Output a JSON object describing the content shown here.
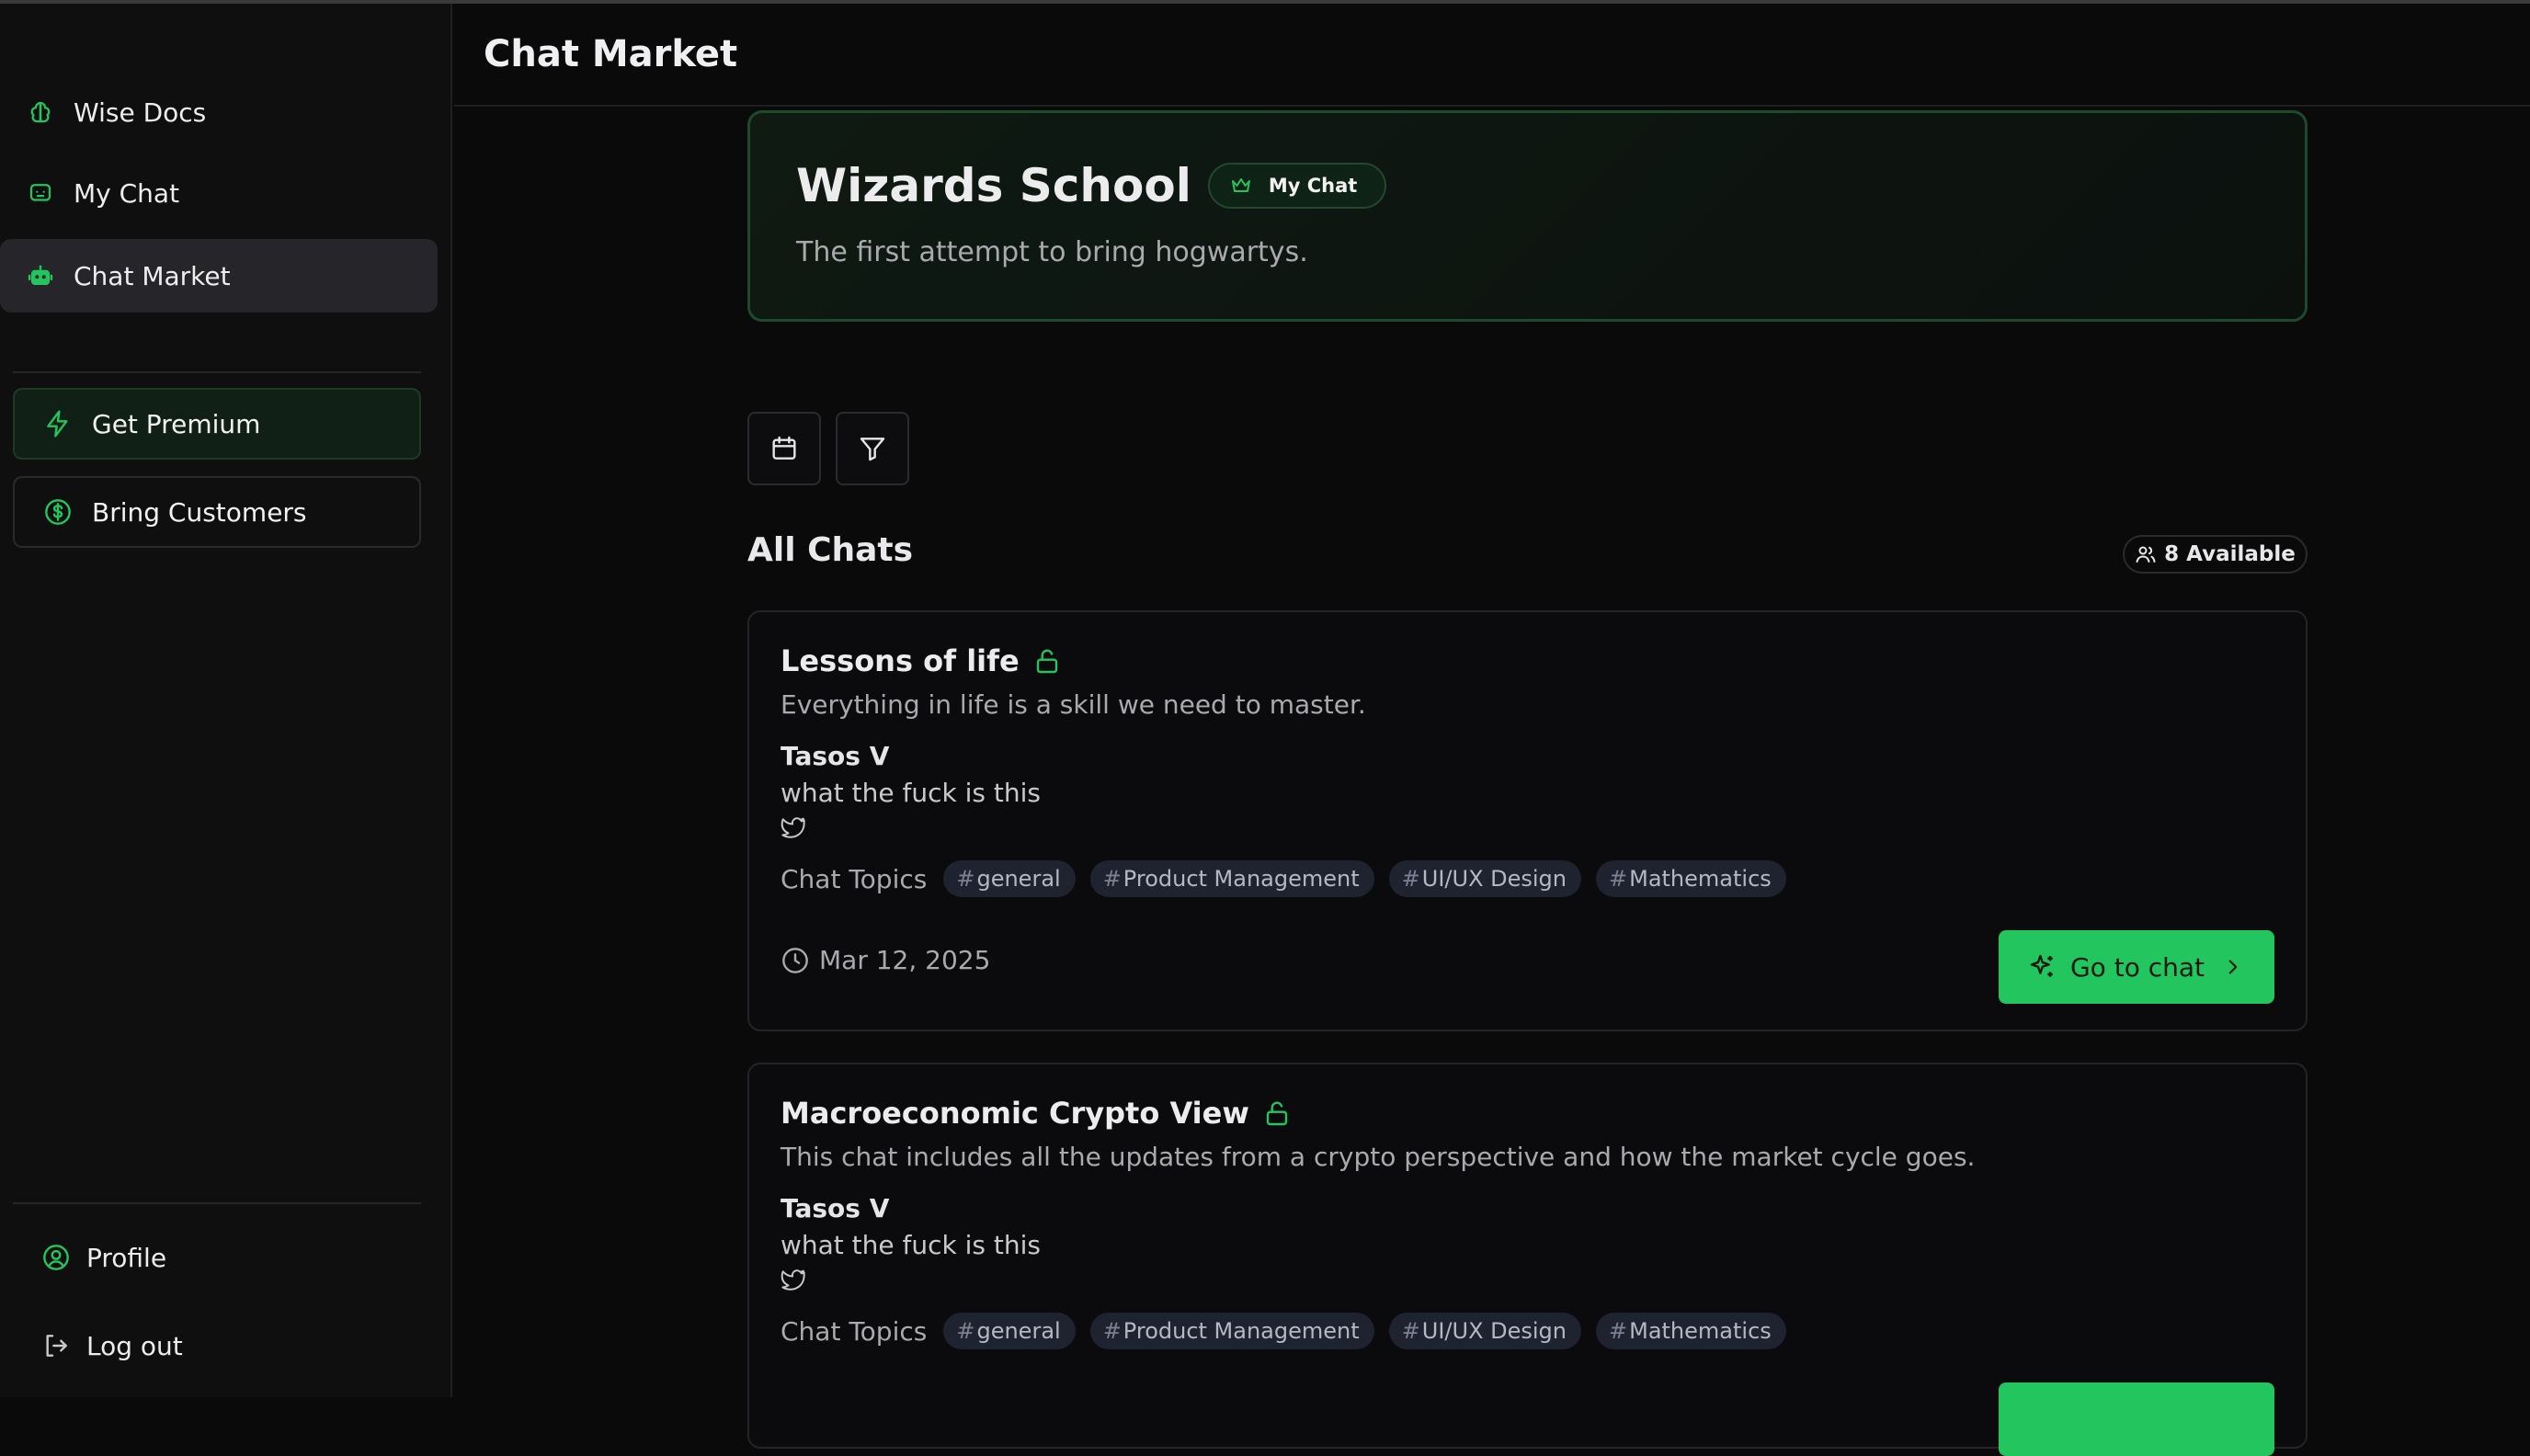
{
  "app": {
    "page_title": "Chat Market"
  },
  "sidebar": {
    "nav": [
      {
        "label": "Wise Docs",
        "icon": "brain-icon"
      },
      {
        "label": "My Chat",
        "icon": "chat-bot-icon"
      },
      {
        "label": "Chat Market",
        "icon": "robot-icon",
        "active": true
      }
    ],
    "actions": [
      {
        "label": "Get Premium",
        "icon": "lightning-icon"
      },
      {
        "label": "Bring Customers",
        "icon": "dollar-circle-icon"
      }
    ],
    "footer": [
      {
        "label": "Profile",
        "icon": "user-circle-icon"
      },
      {
        "label": "Log out",
        "icon": "log-out-icon"
      }
    ]
  },
  "hero": {
    "title": "Wizards School",
    "badge": "My Chat",
    "description": "The first attempt to bring hogwartys."
  },
  "toolbar": {
    "calendar": "calendar-icon",
    "filter": "filter-icon"
  },
  "section": {
    "title": "All Chats",
    "available": "8 Available"
  },
  "chats": [
    {
      "title": "Lessons of life",
      "description": "Everything in life is a skill we need to master.",
      "author": "Tasos V",
      "bio": "what the fuck is this",
      "topics_label": "Chat Topics",
      "topics": [
        "general",
        "Product Management",
        "UI/UX Design",
        "Mathematics"
      ],
      "date": "Mar 12, 2025",
      "button": "Go to chat"
    },
    {
      "title": "Macroeconomic Crypto View",
      "description": "This chat includes all the updates from a crypto perspective and how the market cycle goes.",
      "author": "Tasos V",
      "bio": "what the fuck is this",
      "topics_label": "Chat Topics",
      "topics": [
        "general",
        "Product Management",
        "UI/UX Design",
        "Mathematics"
      ],
      "date": "",
      "button": ""
    }
  ],
  "colors": {
    "accent": "#22c55e",
    "background": "#0a0a0b",
    "sidebar": "#0f0f10",
    "active_item": "#26262a"
  }
}
